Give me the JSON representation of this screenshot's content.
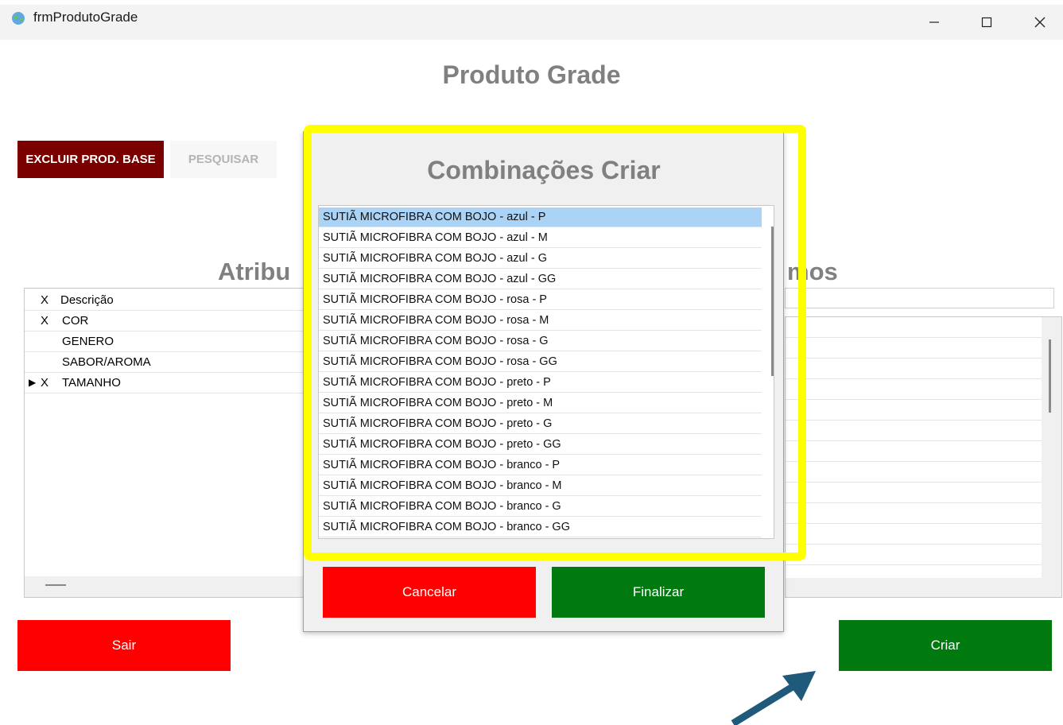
{
  "window": {
    "title": "frmProdutoGrade"
  },
  "page": {
    "title": "Produto Grade"
  },
  "toolbar": {
    "delete_label": "EXCLUIR PROD. BASE",
    "search_label": "PESQUISAR"
  },
  "attributes": {
    "heading": "Atribu",
    "col_x": "X",
    "col_desc": "Descrição",
    "rows": [
      {
        "x": "X",
        "label": "COR"
      },
      {
        "x": "",
        "label": "GENERO"
      },
      {
        "x": "",
        "label": "SABOR/AROMA"
      },
      {
        "x": "X",
        "label": "TAMANHO"
      }
    ]
  },
  "right_panel": {
    "heading": "mos"
  },
  "dialog": {
    "title": "Combinações Criar",
    "items": [
      "SUTIÃ MICROFIBRA COM BOJO - azul - P",
      "SUTIÃ MICROFIBRA COM BOJO - azul - M",
      "SUTIÃ MICROFIBRA COM BOJO - azul - G",
      "SUTIÃ MICROFIBRA COM BOJO - azul - GG",
      "SUTIÃ MICROFIBRA COM BOJO - rosa - P",
      "SUTIÃ MICROFIBRA COM BOJO - rosa - M",
      "SUTIÃ MICROFIBRA COM BOJO - rosa - G",
      "SUTIÃ MICROFIBRA COM BOJO - rosa - GG",
      "SUTIÃ MICROFIBRA COM BOJO - preto - P",
      "SUTIÃ MICROFIBRA COM BOJO - preto - M",
      "SUTIÃ MICROFIBRA COM BOJO - preto - G",
      "SUTIÃ MICROFIBRA COM BOJO - preto - GG",
      "SUTIÃ MICROFIBRA COM BOJO - branco - P",
      "SUTIÃ MICROFIBRA COM BOJO - branco - M",
      "SUTIÃ MICROFIBRA COM BOJO - branco - G",
      "SUTIÃ MICROFIBRA COM BOJO - branco - GG"
    ],
    "cancel_label": "Cancelar",
    "finish_label": "Finalizar"
  },
  "buttons": {
    "exit_label": "Sair",
    "create_label": "Criar"
  },
  "colors": {
    "red": "#ff0000",
    "green": "#007a0e",
    "dark_red": "#7a0000",
    "highlight": "#ffff00",
    "arrow": "#1f5a7a",
    "selection": "#aad3f6"
  }
}
